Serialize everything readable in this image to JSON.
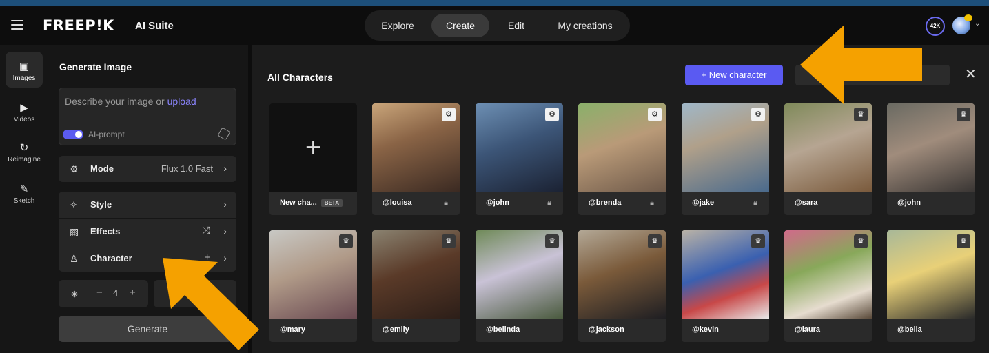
{
  "header": {
    "logo": "FREEP!K",
    "suite": "AI Suite",
    "tabs": [
      {
        "label": "Explore",
        "active": false
      },
      {
        "label": "Create",
        "active": true
      },
      {
        "label": "Edit",
        "active": false
      },
      {
        "label": "My creations",
        "active": false
      }
    ],
    "credits": "42K"
  },
  "rail": {
    "items": [
      {
        "label": "Images",
        "icon": "image-icon",
        "active": true
      },
      {
        "label": "Videos",
        "icon": "video-icon",
        "active": false
      },
      {
        "label": "Reimagine",
        "icon": "refresh-icon",
        "active": false
      },
      {
        "label": "Sketch",
        "icon": "brush-icon",
        "active": false
      }
    ]
  },
  "panel": {
    "title": "Generate Image",
    "prompt_placeholder": "Describe your image or",
    "prompt_link": "upload",
    "ai_prompt_label": "AI-prompt",
    "ai_prompt_on": true,
    "mode_label": "Mode",
    "mode_value": "Flux 1.0 Fast",
    "style_label": "Style",
    "effects_label": "Effects",
    "character_label": "Character",
    "count_value": "4",
    "count_minus": "−",
    "count_plus": "+",
    "generate_label": "Generate"
  },
  "main": {
    "title": "All Characters",
    "new_button": "+ New character",
    "new_card_label": "New cha...",
    "new_card_badge": "BETA",
    "row1": [
      {
        "name": "@louisa",
        "badge": "gear",
        "locked": true
      },
      {
        "name": "@john",
        "badge": "gear",
        "locked": true
      },
      {
        "name": "@brenda",
        "badge": "gear",
        "locked": true
      },
      {
        "name": "@jake",
        "badge": "gear",
        "locked": true
      },
      {
        "name": "@sara",
        "badge": "crown",
        "locked": false
      },
      {
        "name": "@john",
        "badge": "crown",
        "locked": false
      }
    ],
    "row2": [
      {
        "name": "@mary",
        "badge": "crown"
      },
      {
        "name": "@emily",
        "badge": "crown"
      },
      {
        "name": "@belinda",
        "badge": "crown"
      },
      {
        "name": "@jackson",
        "badge": "crown"
      },
      {
        "name": "@kevin",
        "badge": "crown"
      },
      {
        "name": "@laura",
        "badge": "crown"
      },
      {
        "name": "@bella",
        "badge": "crown"
      }
    ]
  },
  "colors": {
    "accent": "#5a5af2",
    "arrow": "#f5a100",
    "background": "#1c1c1c"
  }
}
